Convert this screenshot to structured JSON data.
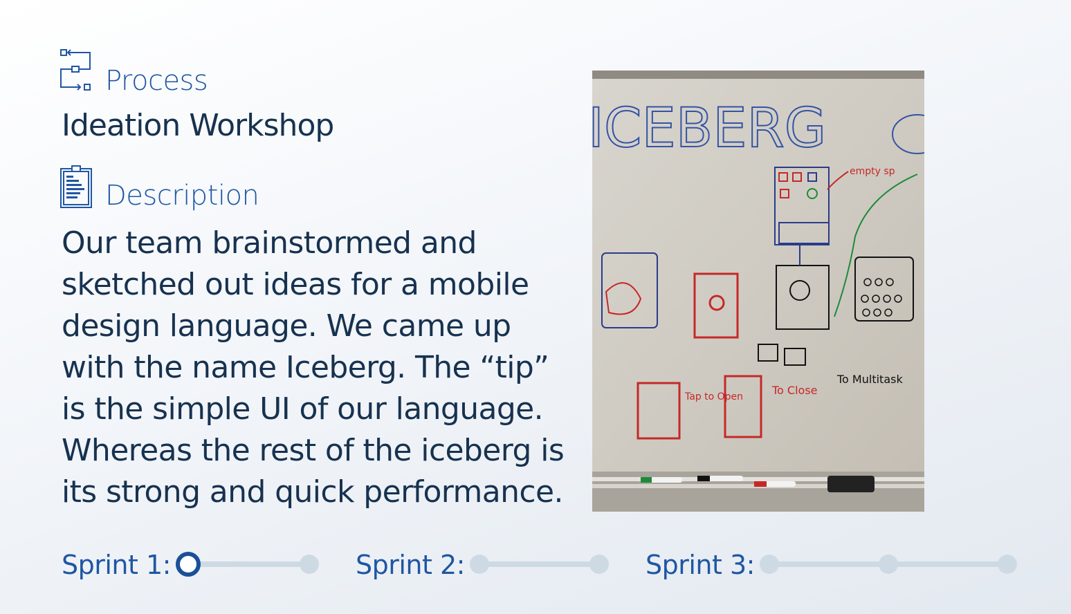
{
  "process": {
    "label": "Process",
    "icon": "process-flow-icon"
  },
  "workshop": {
    "title": "Ideation Workshop"
  },
  "description": {
    "label": "Description",
    "icon": "clipboard-icon",
    "text": "Our team brainstormed and sketched out ideas for a mobile design language. We came up with the name Iceberg. The “tip” is the simple UI of our language. Whereas the rest of the iceberg is its strong and quick performance."
  },
  "photo": {
    "heading": "ICEBERG",
    "notes": [
      "empty sp",
      "To Multitask",
      "Tap to Open",
      "To Close"
    ]
  },
  "sprints": [
    {
      "label": "Sprint 1:",
      "progress": 0,
      "steps": 2
    },
    {
      "label": "Sprint 2:",
      "progress": null,
      "steps": 2
    },
    {
      "label": "Sprint 3:",
      "progress": null,
      "steps": 3
    }
  ],
  "colors": {
    "accent": "#1f56a3",
    "text": "#17324f",
    "track": "#cddae4"
  }
}
